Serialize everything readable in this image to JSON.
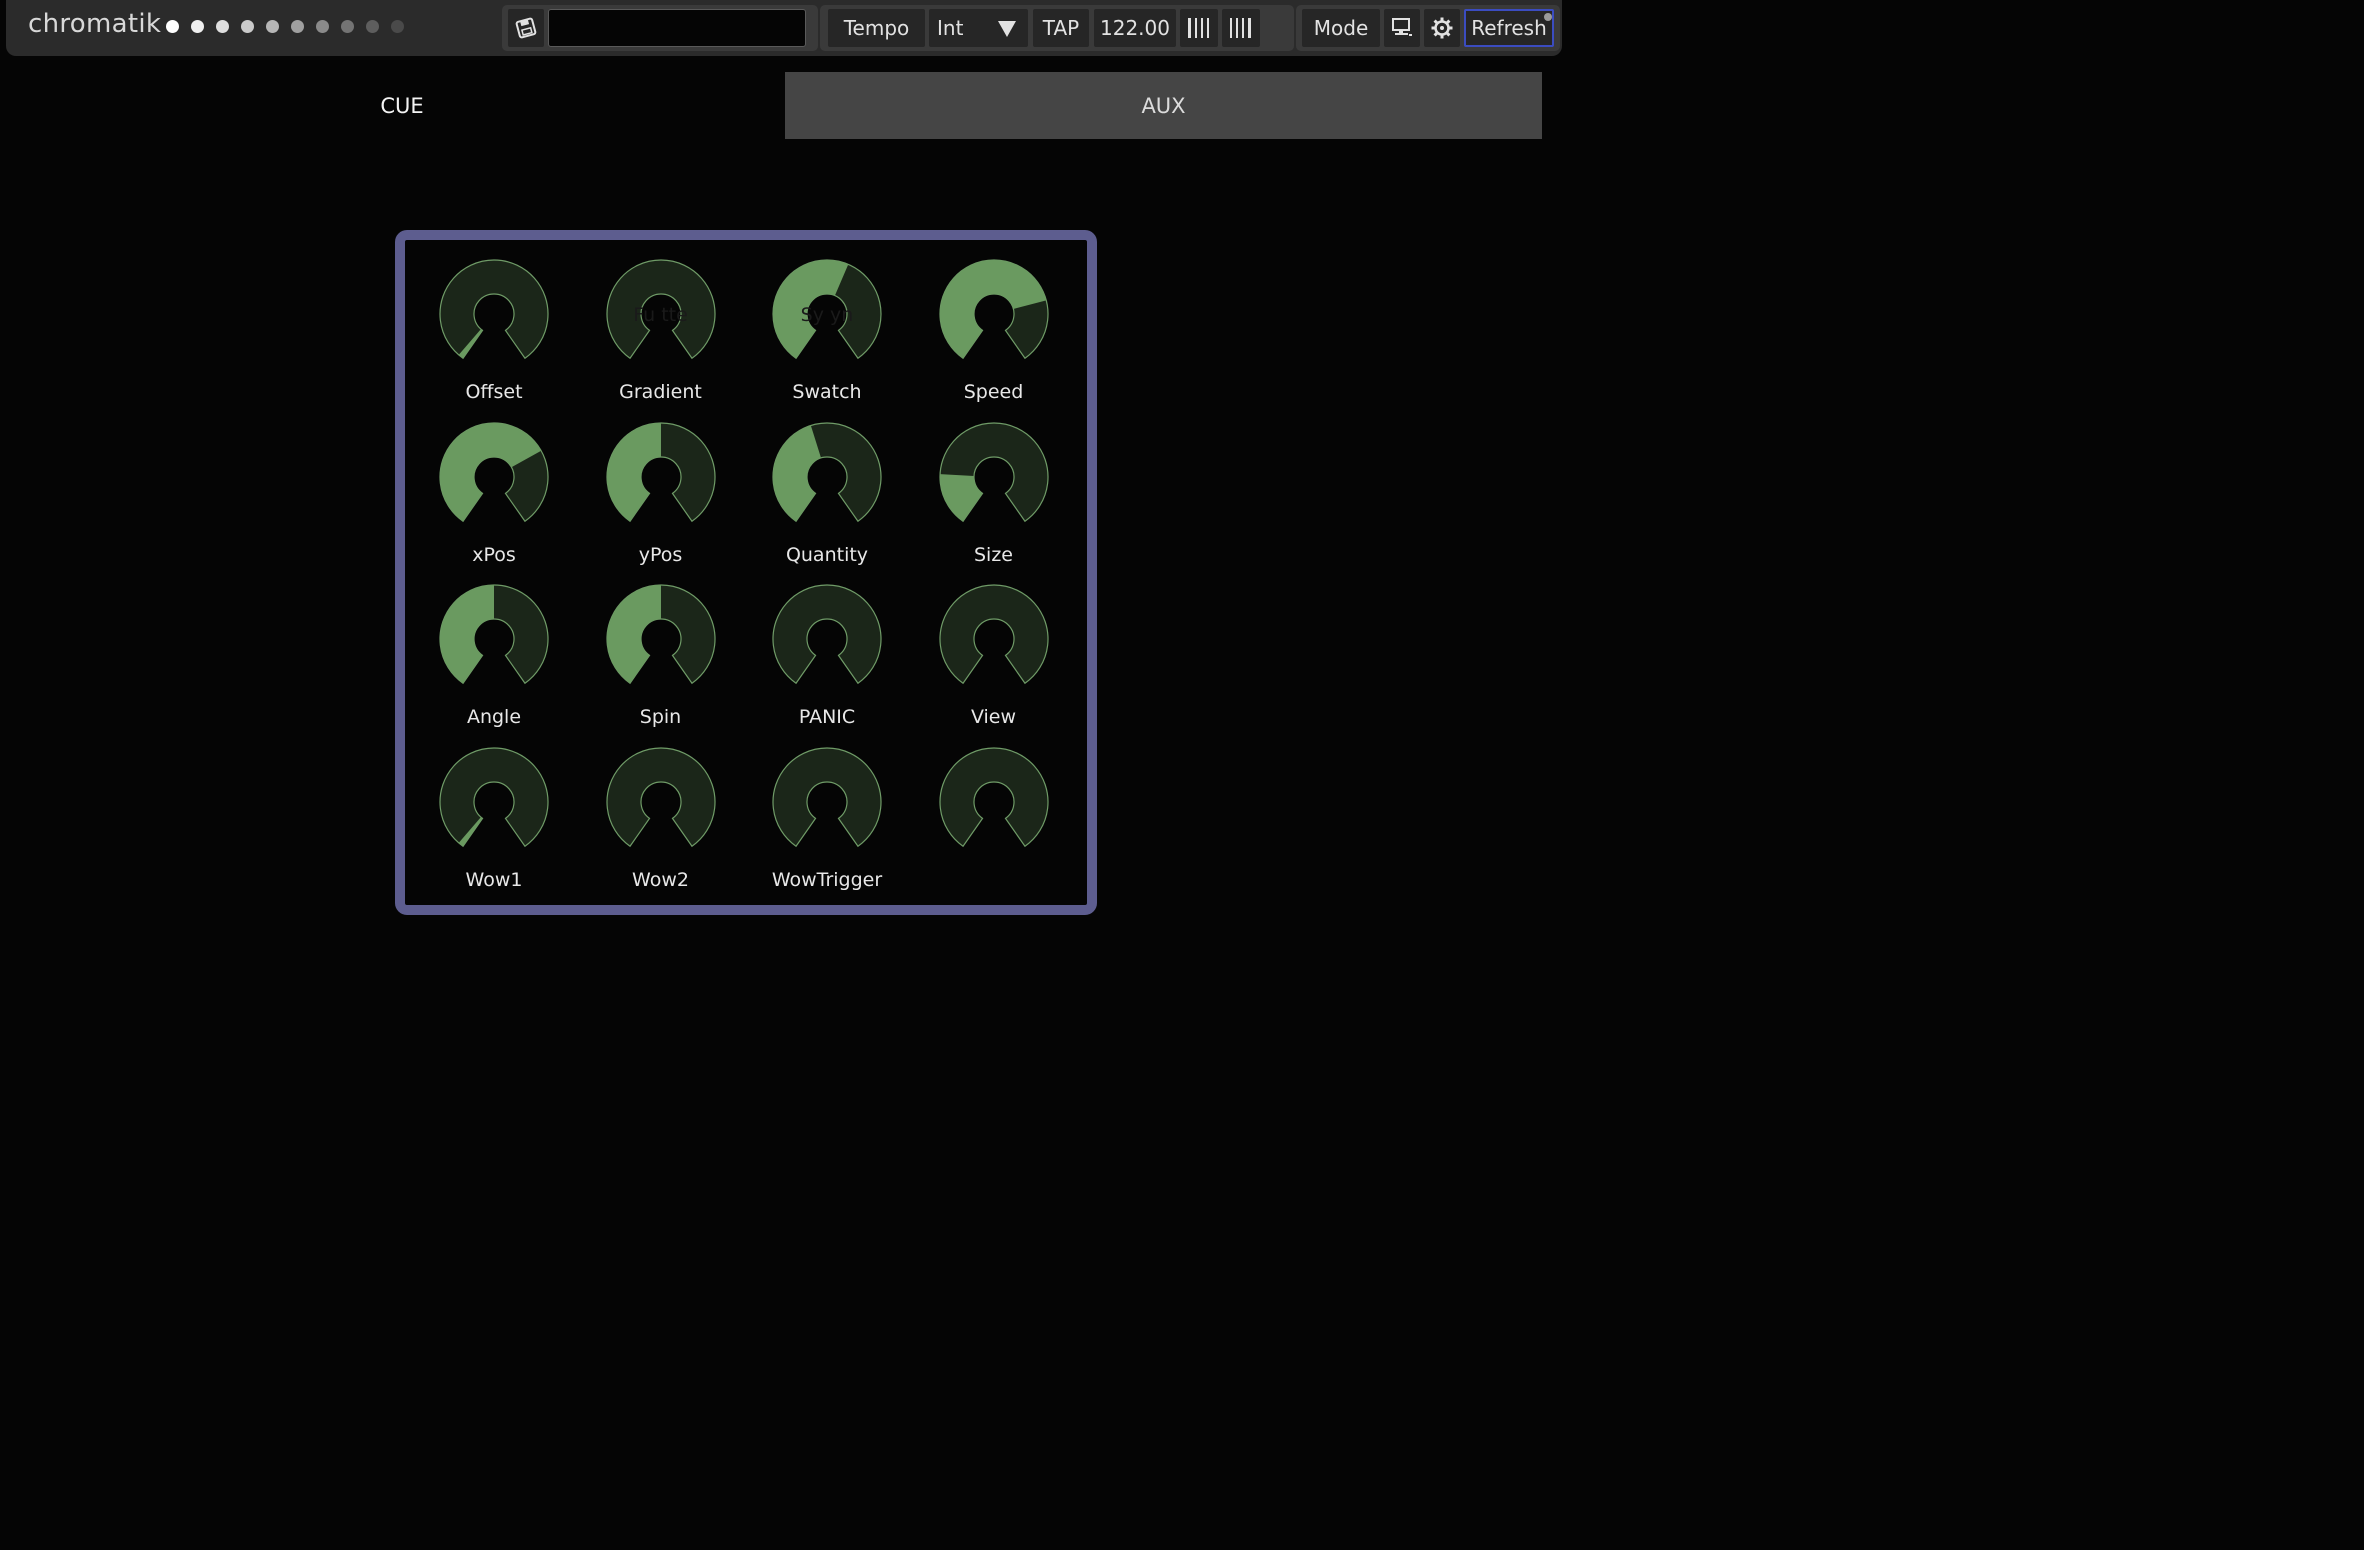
{
  "header": {
    "title": "chromatik",
    "page_dots": [
      "#ffffff",
      "#efefef",
      "#dedede",
      "#cacaca",
      "#b6b6b6",
      "#a0a0a0",
      "#8a8a8a",
      "#747474",
      "#5e5e5e",
      "#4a4a4a"
    ],
    "project_name": "",
    "tempo_label": "Tempo",
    "tempo_source": "Int",
    "tap_label": "TAP",
    "bpm": "122.00",
    "mode_label": "Mode",
    "refresh_label": "Refresh",
    "icons": {
      "save": "save-icon",
      "beat1": "beat-bars-icon",
      "beat2": "beat-bars-icon",
      "monitor": "monitor-icon",
      "settings": "gear-icon"
    }
  },
  "tabs": [
    {
      "label": "CUE",
      "active": true
    },
    {
      "label": "AUX",
      "active": false
    }
  ],
  "colors": {
    "knob_fill": "#6a9a60",
    "knob_track": "#1b2619",
    "knob_outline": "#6f9b67",
    "panel_border": "#5d5d8f",
    "tab_inactive_bg": "#454545"
  },
  "knobs": [
    {
      "label": "Offset",
      "value": 0.02,
      "overlay": ""
    },
    {
      "label": "Gradient",
      "value": 0.0,
      "overlay": "Fu          tte"
    },
    {
      "label": "Swatch",
      "value": 0.58,
      "overlay": "Sy          yn"
    },
    {
      "label": "Speed",
      "value": 0.76,
      "overlay": ""
    },
    {
      "label": "xPos",
      "value": 0.71,
      "overlay": ""
    },
    {
      "label": "yPos",
      "value": 0.5,
      "overlay": ""
    },
    {
      "label": "Quantity",
      "value": 0.44,
      "overlay": ""
    },
    {
      "label": "Size",
      "value": 0.2,
      "overlay": ""
    },
    {
      "label": "Angle",
      "value": 0.5,
      "overlay": ""
    },
    {
      "label": "Spin",
      "value": 0.5,
      "overlay": ""
    },
    {
      "label": "PANIC",
      "value": 0.0,
      "overlay": ""
    },
    {
      "label": "View",
      "value": 0.0,
      "overlay": ""
    },
    {
      "label": "Wow1",
      "value": 0.02,
      "overlay": ""
    },
    {
      "label": "Wow2",
      "value": 0.0,
      "overlay": ""
    },
    {
      "label": "WowTrigger",
      "value": 0.0,
      "overlay": ""
    },
    {
      "label": "",
      "value": 0.0,
      "overlay": ""
    }
  ]
}
